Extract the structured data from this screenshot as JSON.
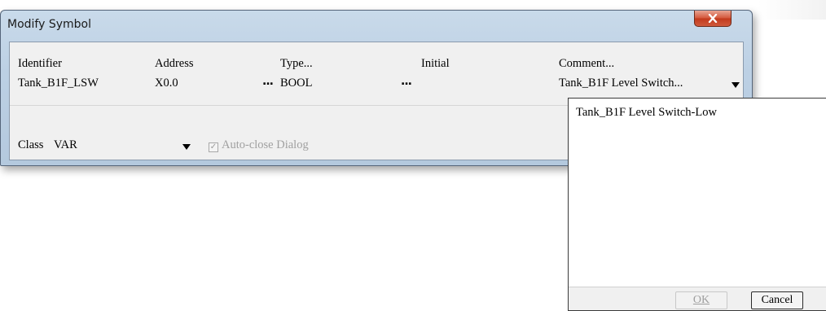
{
  "dialog": {
    "title": "Modify Symbol",
    "close_icon": "close-x-icon"
  },
  "columns": {
    "identifier_label": "Identifier",
    "address_label": "Address",
    "type_label": "Type...",
    "initial_label": "Initial",
    "comment_label": "Comment..."
  },
  "values": {
    "identifier": "Tank_B1F_LSW",
    "address": "X0.0",
    "address_browse": "...",
    "type": "BOOL",
    "type_browse": "...",
    "initial": "",
    "comment": "Tank_B1F Level Switch..."
  },
  "class_row": {
    "label": "Class",
    "value": "VAR",
    "auto_close_label": "Auto-close Dialog",
    "auto_close_checked": true
  },
  "popup": {
    "text": "Tank_B1F Level Switch-Low",
    "ok_label": "OK",
    "cancel_label": "Cancel"
  }
}
